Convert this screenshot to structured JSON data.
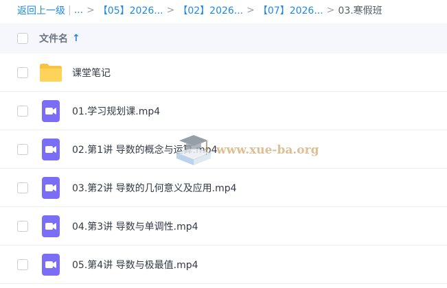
{
  "breadcrumb": {
    "back_label": "返回上一级",
    "bar": "|",
    "ellipsis": "...",
    "sep": ">",
    "folders": [
      "【05】2026...",
      "【02】2026...",
      "【07】2026..."
    ],
    "current": "03.寒假班"
  },
  "header": {
    "column_label": "文件名",
    "sort_icon": "arrow-up-icon",
    "sort_glyph": "↑"
  },
  "files": [
    {
      "name": "课堂笔记",
      "type": "folder",
      "icon": "folder-icon"
    },
    {
      "name": "01.学习规划课.mp4",
      "type": "video",
      "icon": "video-file-icon"
    },
    {
      "name": "02.第1讲 导数的概念与运算.mp4",
      "type": "video",
      "icon": "video-file-icon"
    },
    {
      "name": "03.第2讲 导数的几何意义及应用.mp4",
      "type": "video",
      "icon": "video-file-icon"
    },
    {
      "name": "04.第3讲 导数与单调性.mp4",
      "type": "video",
      "icon": "video-file-icon"
    },
    {
      "name": "05.第4讲 导数与极最值.mp4",
      "type": "video",
      "icon": "video-file-icon"
    }
  ],
  "watermark": {
    "text": "www.xue-ba.org",
    "icon": "graduation-cap-book-icon"
  },
  "colors": {
    "link": "#1e88e5",
    "folder": "#fdd35a",
    "video": "#7b6ef6",
    "header_bg": "#f5f7fc"
  }
}
